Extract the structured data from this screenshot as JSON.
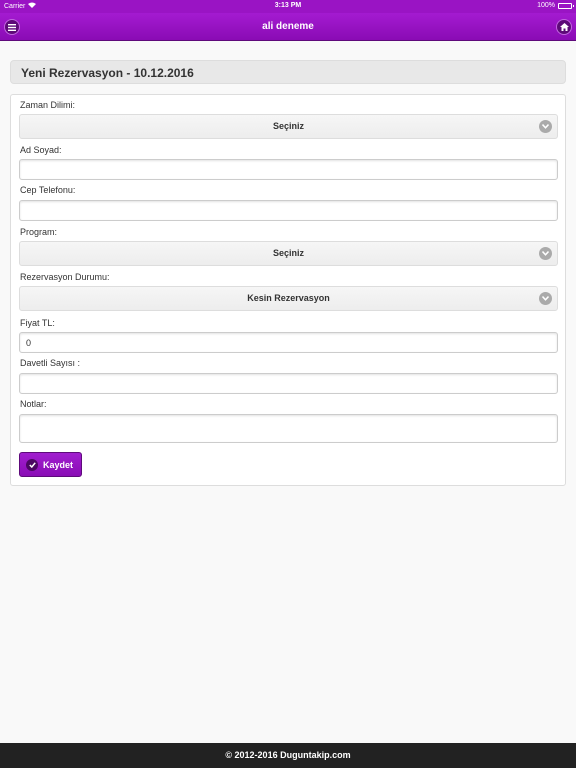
{
  "status_bar": {
    "carrier": "Carrier",
    "time": "3:13 PM",
    "battery": "100%",
    "battery_level": 1.0
  },
  "header": {
    "title": "ali deneme",
    "menu_icon": "menu-icon",
    "home_icon": "home-icon"
  },
  "page": {
    "title": "Yeni Rezervasyon - 10.12.2016"
  },
  "form": {
    "time_slot": {
      "label": "Zaman Dilimi:",
      "value": "Seçiniz"
    },
    "full_name": {
      "label": "Ad Soyad:",
      "value": ""
    },
    "mobile_phone": {
      "label": "Cep Telefonu:",
      "value": ""
    },
    "program": {
      "label": "Program:",
      "value": "Seçiniz"
    },
    "reservation_status": {
      "label": "Rezervasyon Durumu:",
      "value": "Kesin Rezervasyon"
    },
    "price": {
      "label": "Fiyat TL:",
      "value": "0"
    },
    "guest_count": {
      "label": "Davetli Sayısı :",
      "value": ""
    },
    "notes": {
      "label": "Notlar:",
      "value": ""
    },
    "save_label": "Kaydet"
  },
  "footer": {
    "text": "© 2012-2016 Duguntakip.com"
  },
  "colors": {
    "brand": "#9a14c4",
    "footer_bg": "#222222"
  }
}
